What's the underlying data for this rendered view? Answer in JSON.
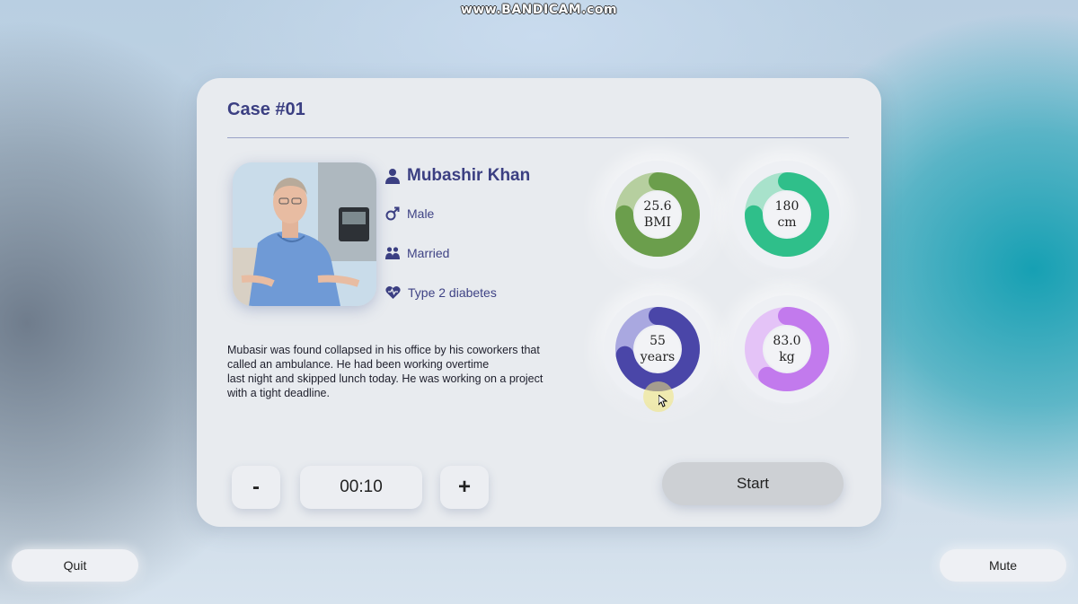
{
  "watermark": "www.BANDICAM.com",
  "case": {
    "title": "Case #01"
  },
  "patient": {
    "name": "Mubashir Khan",
    "gender": "Male",
    "marital_status": "Married",
    "condition": "Type 2 diabetes",
    "description": "Mubasir was found collapsed in his office by his coworkers that\ncalled an ambulance. He had been working overtime\nlast night and skipped lunch today. He was working on a project\nwith a tight deadline."
  },
  "stats": [
    {
      "value": "25.6",
      "unit": "BMI",
      "fraction": 0.75,
      "color": "#6b9e4c",
      "track": "#b6cf9f"
    },
    {
      "value": "180",
      "unit": "cm",
      "fraction": 0.75,
      "color": "#2fbf8a",
      "track": "#a8e2cb"
    },
    {
      "value": "55",
      "unit": "years",
      "fraction": 0.72,
      "color": "#4a46a8",
      "track": "#a9a8e0"
    },
    {
      "value": "83.0",
      "unit": "kg",
      "fraction": 0.6,
      "color": "#c27aed",
      "track": "#e4c3f7"
    }
  ],
  "timer": {
    "decrement_label": "-",
    "value": "00:10",
    "increment_label": "+"
  },
  "actions": {
    "start_label": "Start",
    "quit_label": "Quit",
    "mute_label": "Mute"
  },
  "icons": {
    "name": "person-icon",
    "gender": "male-icon",
    "marital": "couple-icon",
    "condition": "heart-health-icon"
  }
}
